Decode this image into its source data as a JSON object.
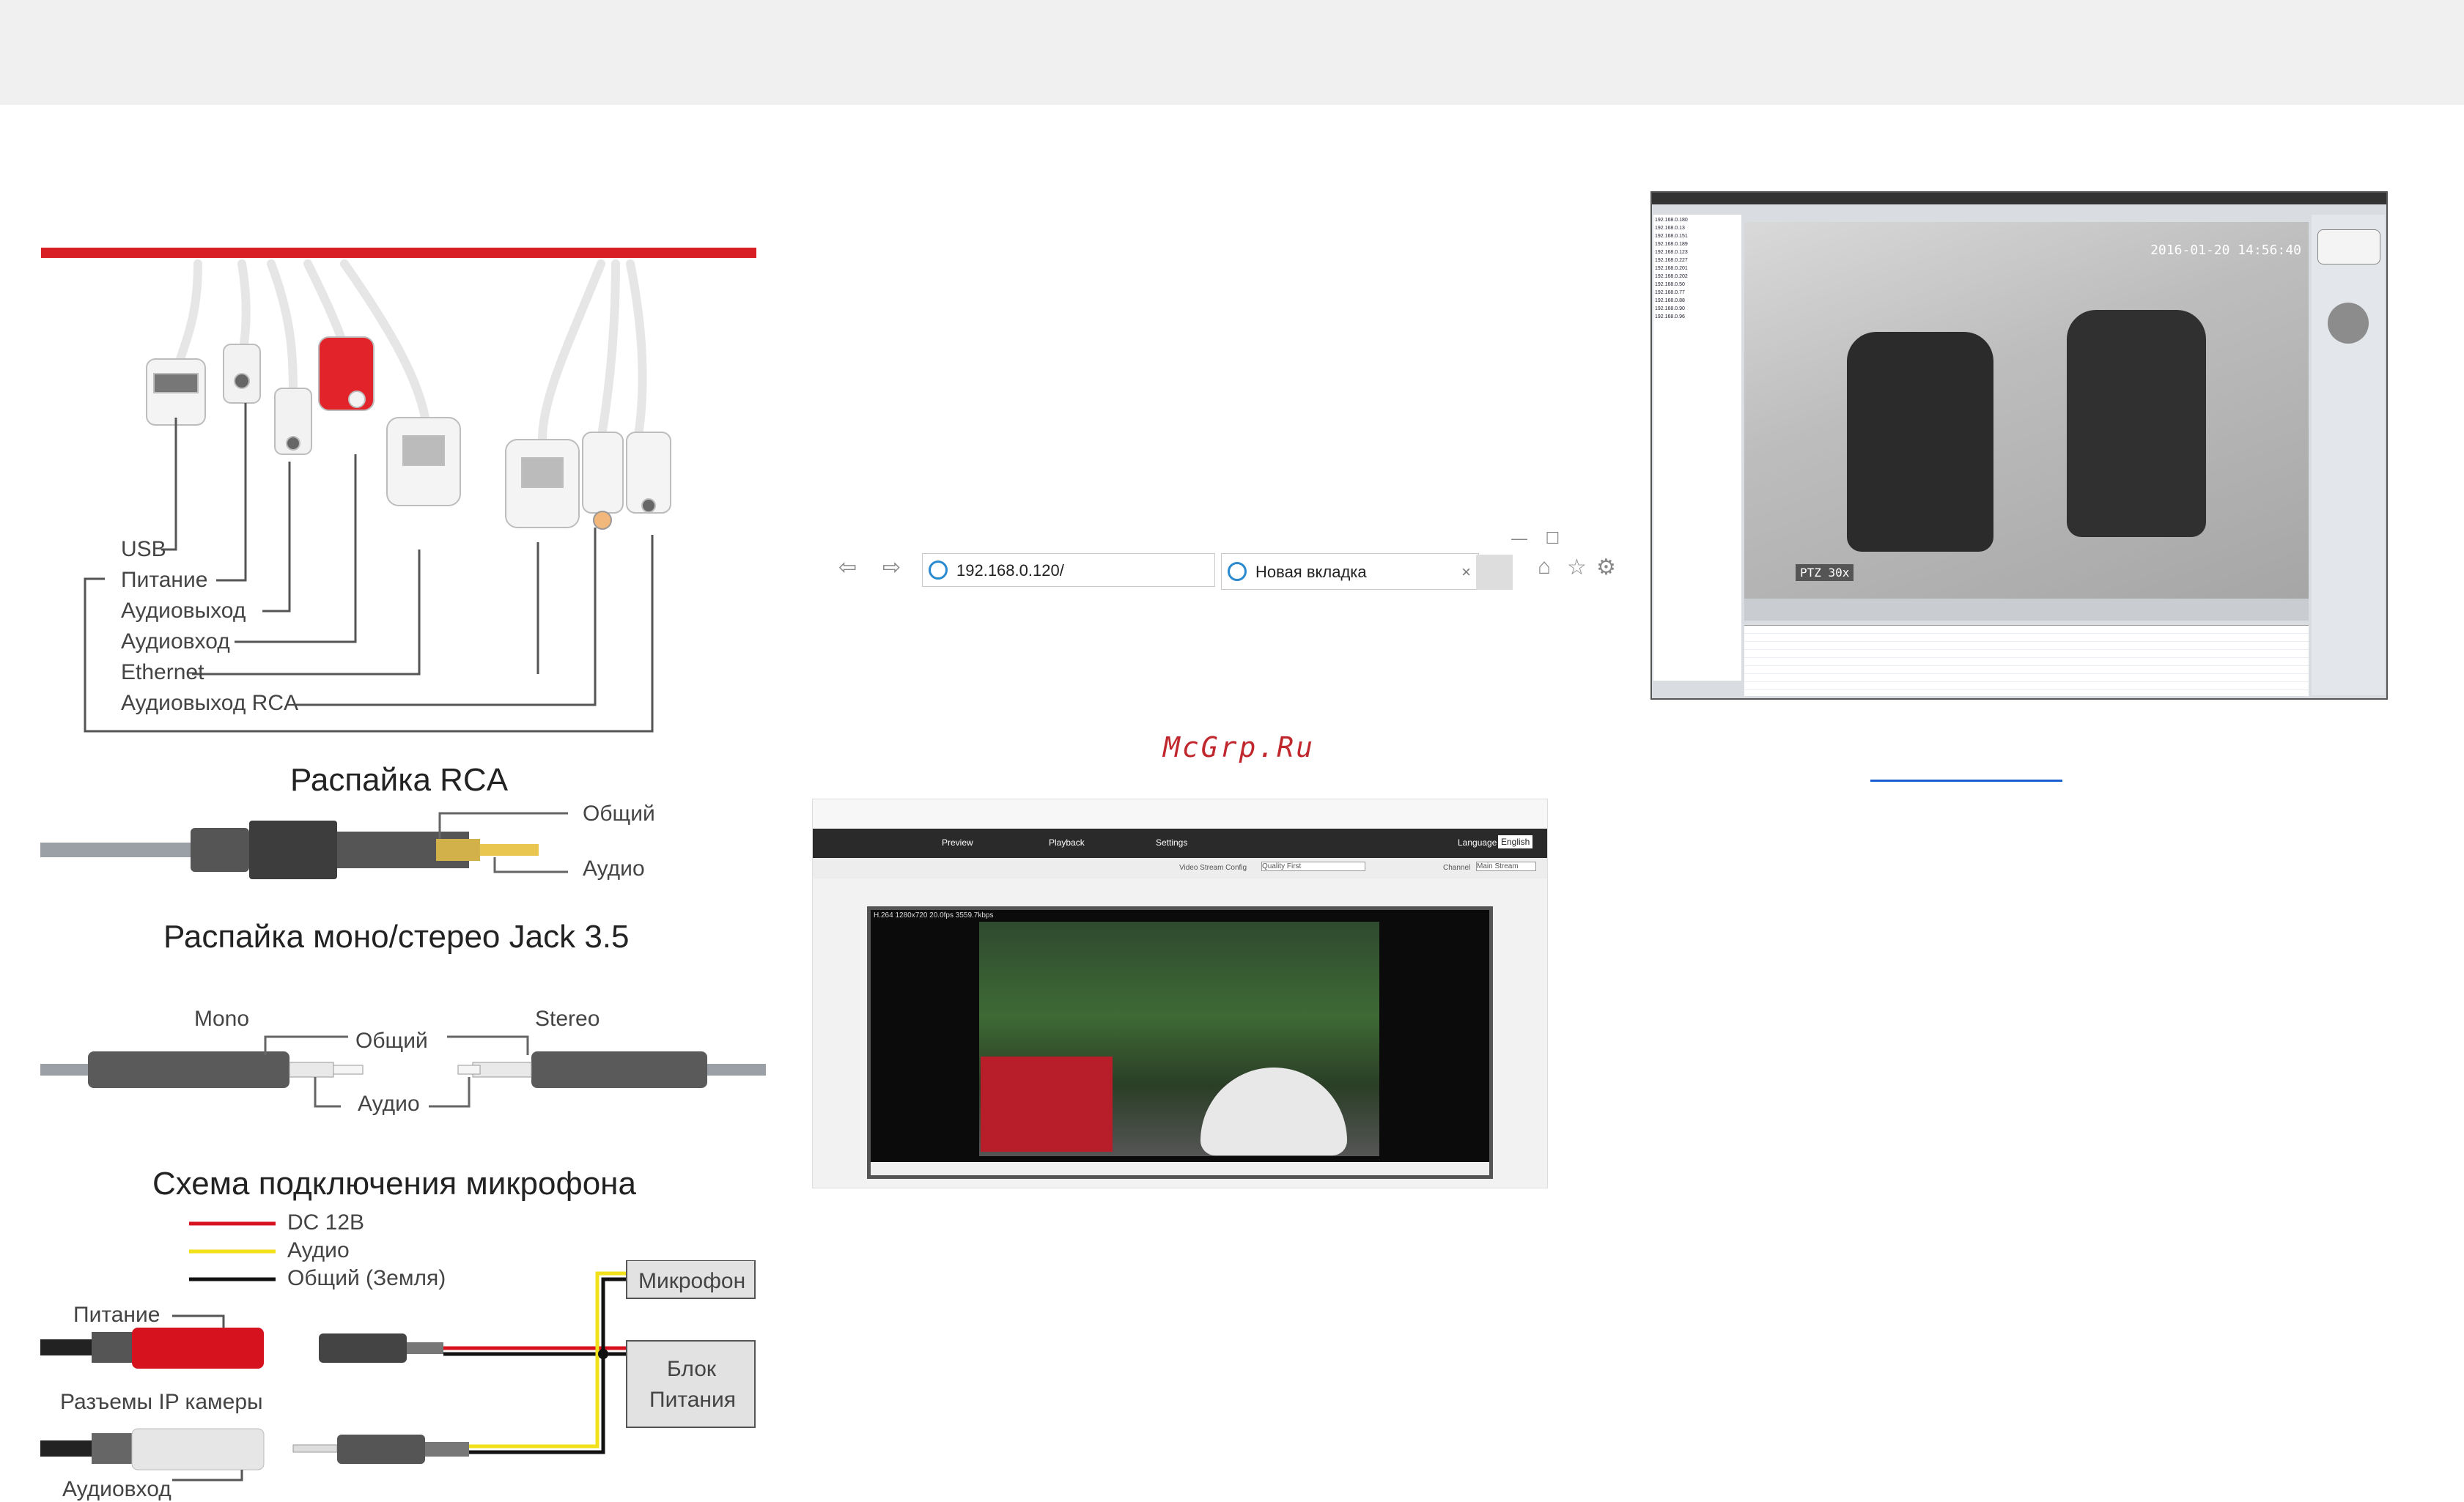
{
  "pinout": {
    "usb": "USB",
    "power": "Питание",
    "audio_out": "Аудиовыход",
    "audio_in": "Аудиовход",
    "ethernet": "Ethernet",
    "audio_out_rca": "Аудиовыход RCA"
  },
  "rca": {
    "title": "Распайка RCA",
    "common": "Общий",
    "audio": "Аудио"
  },
  "jack": {
    "title": "Распайка моно/стерео Jack 3.5",
    "mono": "Mono",
    "stereo": "Stereo",
    "common": "Общий",
    "audio": "Аудио"
  },
  "mic": {
    "title": "Схема подключения микрофона",
    "legend_dc": "DC 12В",
    "legend_audio": "Аудио",
    "legend_ground": "Общий (Земля)",
    "power": "Питание",
    "camera_connectors": "Разъемы IP камеры",
    "audio_in": "Аудиовход",
    "microphone": "Микрофон",
    "psu_line1": "Блок",
    "psu_line2": "Питания",
    "colors": {
      "dc": "#d6121f",
      "audio": "#f2e01a",
      "ground": "#111111"
    }
  },
  "browser": {
    "address": "192.168.0.120/",
    "tab_title": "Новая вкладка"
  },
  "watermark": "McGrp.Ru",
  "web_ui": {
    "tabs": [
      "Preview",
      "Playback",
      "Settings"
    ],
    "language_label": "Language",
    "language_value": "English",
    "stream_config_label": "Video Stream Config",
    "stream_config_value": "Quality First",
    "channel_label": "Channel",
    "channel_value": "Main Stream",
    "stream_info": "H.264 1280x720 20.0fps 3559.7kbps"
  },
  "cms": {
    "timestamp": "2016-01-20 14:56:40",
    "ptz_label": "PTZ 30x",
    "device_list": [
      "192.168.0.180",
      "192.168.0.13",
      "192.168.0.151",
      "192.168.0.189",
      "192.168.0.123",
      "192.168.0.227",
      "192.168.0.201",
      "192.168.0.202",
      "192.168.0.50",
      "192.168.0.77",
      "192.168.0.88",
      "192.168.0.90",
      "192.168.0.96"
    ]
  }
}
